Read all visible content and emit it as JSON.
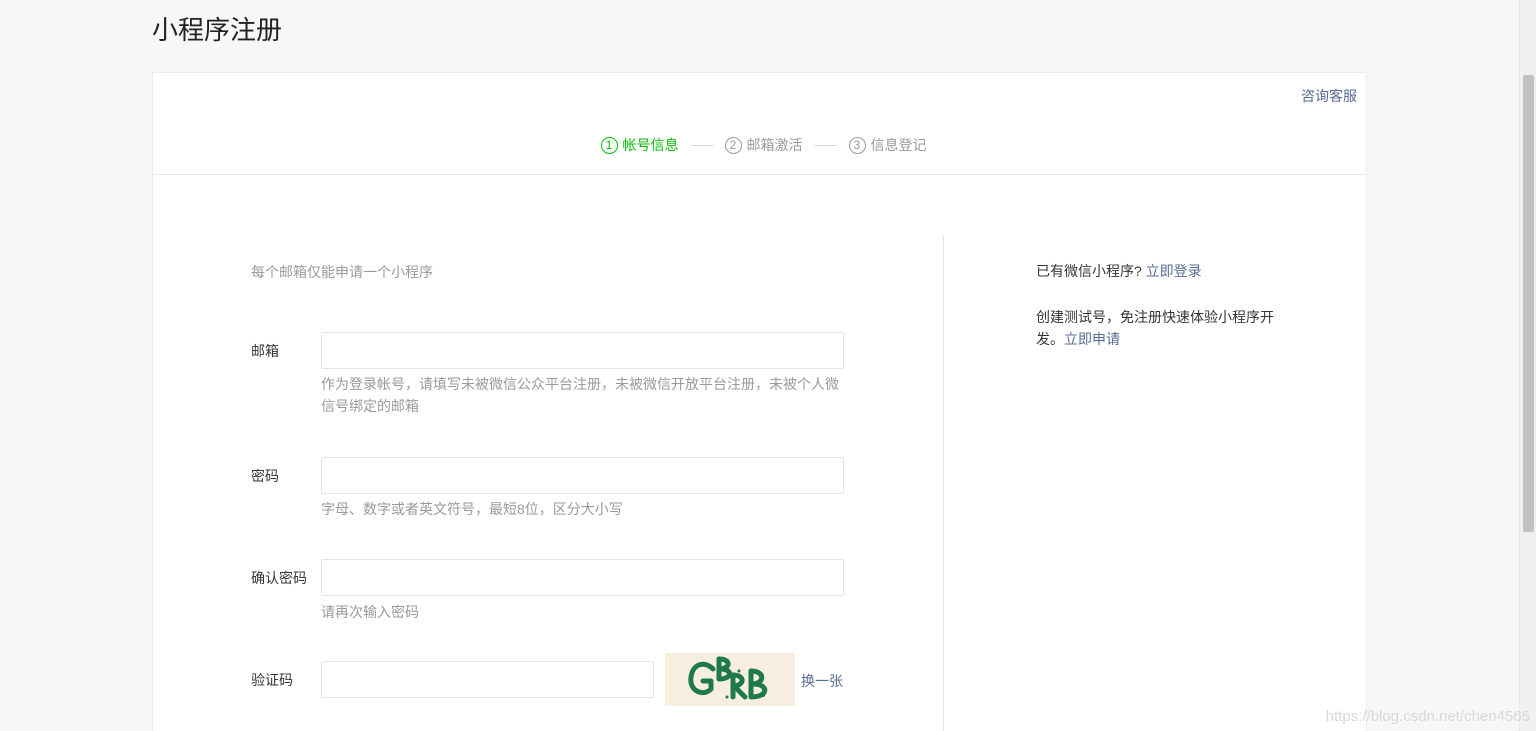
{
  "page": {
    "title": "小程序注册"
  },
  "header": {
    "service_link": "咨询客服"
  },
  "steps": [
    {
      "num": "1",
      "label": "帐号信息",
      "active": true
    },
    {
      "num": "2",
      "label": "邮箱激活",
      "active": false
    },
    {
      "num": "3",
      "label": "信息登记",
      "active": false
    }
  ],
  "form": {
    "tip": "每个邮箱仅能申请一个小程序",
    "email": {
      "label": "邮箱",
      "value": "",
      "hint": "作为登录帐号，请填写未被微信公众平台注册，未被微信开放平台注册，未被个人微信号绑定的邮箱"
    },
    "password": {
      "label": "密码",
      "value": "",
      "hint": "字母、数字或者英文符号，最短8位，区分大小写"
    },
    "confirm_password": {
      "label": "确认密码",
      "value": "",
      "hint": "请再次输入密码"
    },
    "captcha": {
      "label": "验证码",
      "value": "",
      "image_text": "GBRB",
      "refresh_label": "换一张"
    }
  },
  "side": {
    "login_prompt": "已有微信小程序?",
    "login_link": "立即登录",
    "test_prompt": "创建测试号，免注册快速体验小程序开发。",
    "test_link": "立即申请"
  },
  "watermark": "https://blog.csdn.net/chen4565",
  "colors": {
    "accent": "#09bb07",
    "link": "#576b95",
    "muted": "#9a9a9a"
  }
}
